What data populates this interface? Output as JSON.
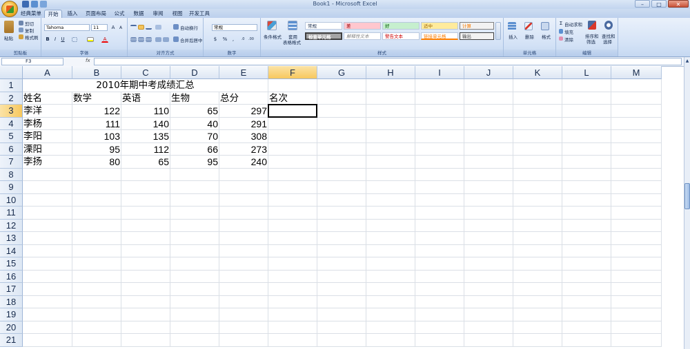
{
  "window": {
    "title": "Book1 - Microsoft Excel",
    "min": "–",
    "max": "□",
    "close": "✕"
  },
  "tabs": [
    "经典菜单",
    "开始",
    "插入",
    "页面布局",
    "公式",
    "数据",
    "审阅",
    "视图",
    "开发工具"
  ],
  "active_tab": "开始",
  "ribbon": {
    "clipboard": {
      "label": "剪贴板",
      "paste": "粘贴",
      "cut": "剪切",
      "copy": "复制",
      "format_painter": "格式刷"
    },
    "font": {
      "label": "字体",
      "name": "Tahoma",
      "size": "11"
    },
    "alignment": {
      "label": "对齐方式",
      "wrap": "自动换行",
      "merge": "合并后居中"
    },
    "number": {
      "label": "数字",
      "format": "常规"
    },
    "styles": {
      "label": "样式",
      "conditional": "条件格式",
      "table": "套用",
      "table2": "表格格式",
      "cells": [
        "常规",
        "差",
        "好",
        "适中",
        "计算",
        "检查单元格",
        "解释性文本",
        "警告文本",
        "链接单元格",
        "输出"
      ]
    },
    "cells_group": {
      "label": "单元格",
      "insert": "插入",
      "delete": "删除",
      "format": "格式"
    },
    "editing": {
      "label": "编辑",
      "autosum": "自动求和",
      "fill": "填充",
      "clear": "清除",
      "sort": "排序和",
      "sort2": "筛选",
      "find": "查找和",
      "find2": "选择"
    }
  },
  "formula_bar": {
    "name_box": "F3",
    "fx": "fx",
    "content": ""
  },
  "columns": [
    "A",
    "B",
    "C",
    "D",
    "E",
    "F",
    "G",
    "H",
    "I",
    "J",
    "K",
    "L",
    "M"
  ],
  "rows": [
    "1",
    "2",
    "3",
    "4",
    "5",
    "6",
    "7",
    "8",
    "9",
    "10",
    "11",
    "12",
    "13",
    "14",
    "15",
    "16",
    "17",
    "18",
    "19",
    "20",
    "21"
  ],
  "selected_cell": "F3",
  "sheet": {
    "title": "2010年期中考成绩汇总",
    "headers": [
      "姓名",
      "数学",
      "英语",
      "生物",
      "总分",
      "名次"
    ],
    "data": [
      [
        "李洋",
        "122",
        "110",
        "65",
        "297"
      ],
      [
        "李杨",
        "111",
        "140",
        "40",
        "291"
      ],
      [
        "李阳",
        "103",
        "135",
        "70",
        "308"
      ],
      [
        "溧阳",
        "95",
        "112",
        "66",
        "273"
      ],
      [
        "李扬",
        "80",
        "65",
        "95",
        "240"
      ]
    ]
  }
}
